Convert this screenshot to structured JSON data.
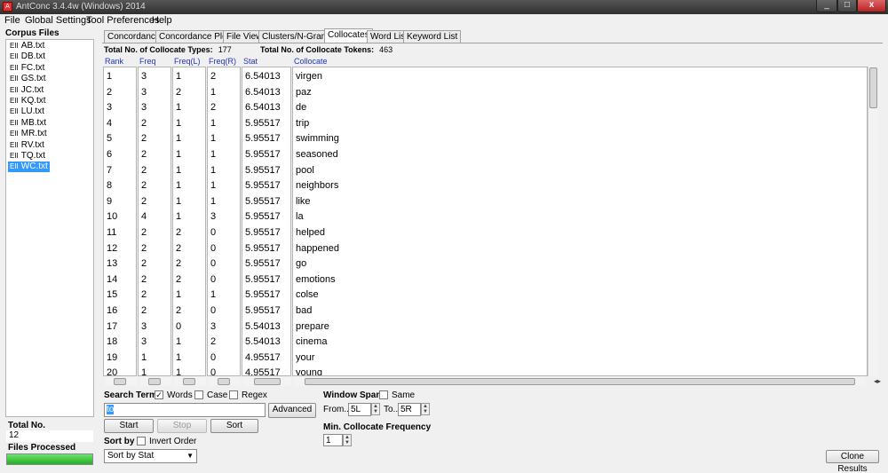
{
  "window": {
    "title": "AntConc 3.4.4w (Windows) 2014",
    "app_icon": "A",
    "minimize": "_",
    "maximize": "□",
    "close": "x"
  },
  "menu": [
    "File",
    "Global Settings",
    "Tool Preferences",
    "Help"
  ],
  "corpus": {
    "header": "Corpus Files",
    "files": [
      "AB.txt",
      "DB.txt",
      "FC.txt",
      "GS.txt",
      "JC.txt",
      "KQ.txt",
      "LU.txt",
      "MB.txt",
      "MR.txt",
      "RV.txt",
      "TQ.txt",
      "WC.txt"
    ],
    "selected_index": 11,
    "file_icon": "EII",
    "total_label": "Total No.",
    "total_value": "12",
    "processed_label": "Files Processed",
    "processed_fraction": 1.0
  },
  "tabs": [
    "Concordance",
    "Concordance Plot",
    "File View",
    "Clusters/N-Grams",
    "Collocates",
    "Word List",
    "Keyword List"
  ],
  "active_tab": "Collocates",
  "summary": {
    "types_label": "Total No. of Collocate Types:",
    "types_value": "177",
    "tokens_label": "Total No. of Collocate Tokens:",
    "tokens_value": "463"
  },
  "columns": [
    "Rank",
    "Freq",
    "Freq(L)",
    "Freq(R)",
    "Stat",
    "Collocate"
  ],
  "rows": [
    [
      "1",
      "3",
      "1",
      "2",
      "6.54013",
      "virgen"
    ],
    [
      "2",
      "3",
      "2",
      "1",
      "6.54013",
      "paz"
    ],
    [
      "3",
      "3",
      "1",
      "2",
      "6.54013",
      "de"
    ],
    [
      "4",
      "2",
      "1",
      "1",
      "5.95517",
      "trip"
    ],
    [
      "5",
      "2",
      "1",
      "1",
      "5.95517",
      "swimming"
    ],
    [
      "6",
      "2",
      "1",
      "1",
      "5.95517",
      "seasoned"
    ],
    [
      "7",
      "2",
      "1",
      "1",
      "5.95517",
      "pool"
    ],
    [
      "8",
      "2",
      "1",
      "1",
      "5.95517",
      "neighbors"
    ],
    [
      "9",
      "2",
      "1",
      "1",
      "5.95517",
      "like"
    ],
    [
      "10",
      "4",
      "1",
      "3",
      "5.95517",
      "la"
    ],
    [
      "11",
      "2",
      "2",
      "0",
      "5.95517",
      "helped"
    ],
    [
      "12",
      "2",
      "2",
      "0",
      "5.95517",
      "happened"
    ],
    [
      "13",
      "2",
      "2",
      "0",
      "5.95517",
      "go"
    ],
    [
      "14",
      "2",
      "2",
      "0",
      "5.95517",
      "emotions"
    ],
    [
      "15",
      "2",
      "1",
      "1",
      "5.95517",
      "colse"
    ],
    [
      "16",
      "2",
      "2",
      "0",
      "5.95517",
      "bad"
    ],
    [
      "17",
      "3",
      "0",
      "3",
      "5.54013",
      "prepare"
    ],
    [
      "18",
      "3",
      "1",
      "2",
      "5.54013",
      "cinema"
    ],
    [
      "19",
      "1",
      "1",
      "0",
      "4.95517",
      "your"
    ],
    [
      "20",
      "1",
      "1",
      "0",
      "4.95517",
      "young"
    ]
  ],
  "search": {
    "label": "Search Term",
    "words_label": "Words",
    "words_checked": true,
    "case_label": "Case",
    "case_checked": false,
    "regex_label": "Regex",
    "regex_checked": false,
    "term": "to",
    "advanced": "Advanced",
    "start": "Start",
    "stop": "Stop",
    "sort": "Sort"
  },
  "sort_by": {
    "label": "Sort by",
    "invert_label": "Invert Order",
    "invert_checked": false,
    "selected": "Sort by Stat"
  },
  "window_span": {
    "label": "Window Span",
    "same_label": "Same",
    "same_checked": false,
    "from_label": "From...",
    "from_value": "5L",
    "to_label": "To...",
    "to_value": "5R"
  },
  "min_freq": {
    "label": "Min. Collocate Frequency",
    "value": "1"
  },
  "clone_results": "Clone Results"
}
